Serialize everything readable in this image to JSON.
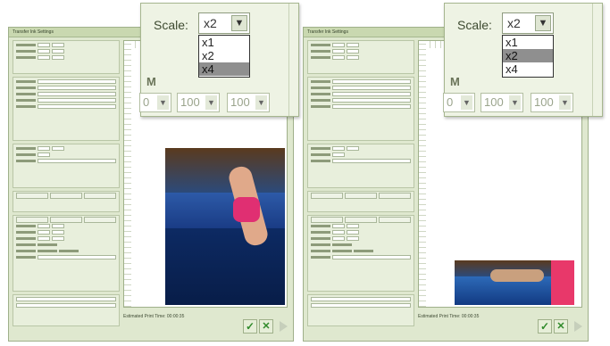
{
  "windows": [
    {
      "id": "left",
      "title": "Transfer Ink Settings",
      "status": "Estimated Print Time: 00:00:35"
    },
    {
      "id": "right",
      "title": "Transfer Ink Settings",
      "status": "Estimated Print Time: 00:00:35"
    }
  ],
  "zoom_left": {
    "scale_label": "Scale:",
    "selected": "x2",
    "options": [
      "x1",
      "x2",
      "x4"
    ],
    "highlighted": "x4",
    "m_label": "M",
    "inputs": [
      "0",
      "100",
      "100"
    ]
  },
  "zoom_right": {
    "scale_label": "Scale:",
    "selected": "x2",
    "options": [
      "x1",
      "x2",
      "x4"
    ],
    "highlighted": "x2",
    "m_label": "M",
    "inputs": [
      "0",
      "100",
      "100"
    ]
  },
  "icons": {
    "ok": "check-icon",
    "cancel": "x-icon",
    "next": "play-icon",
    "dropdown": "chevron-down-icon"
  },
  "colors": {
    "window_bg": "#dfe8cf",
    "accent_green": "#2f8a2a",
    "highlight": "#8f8f8f"
  }
}
